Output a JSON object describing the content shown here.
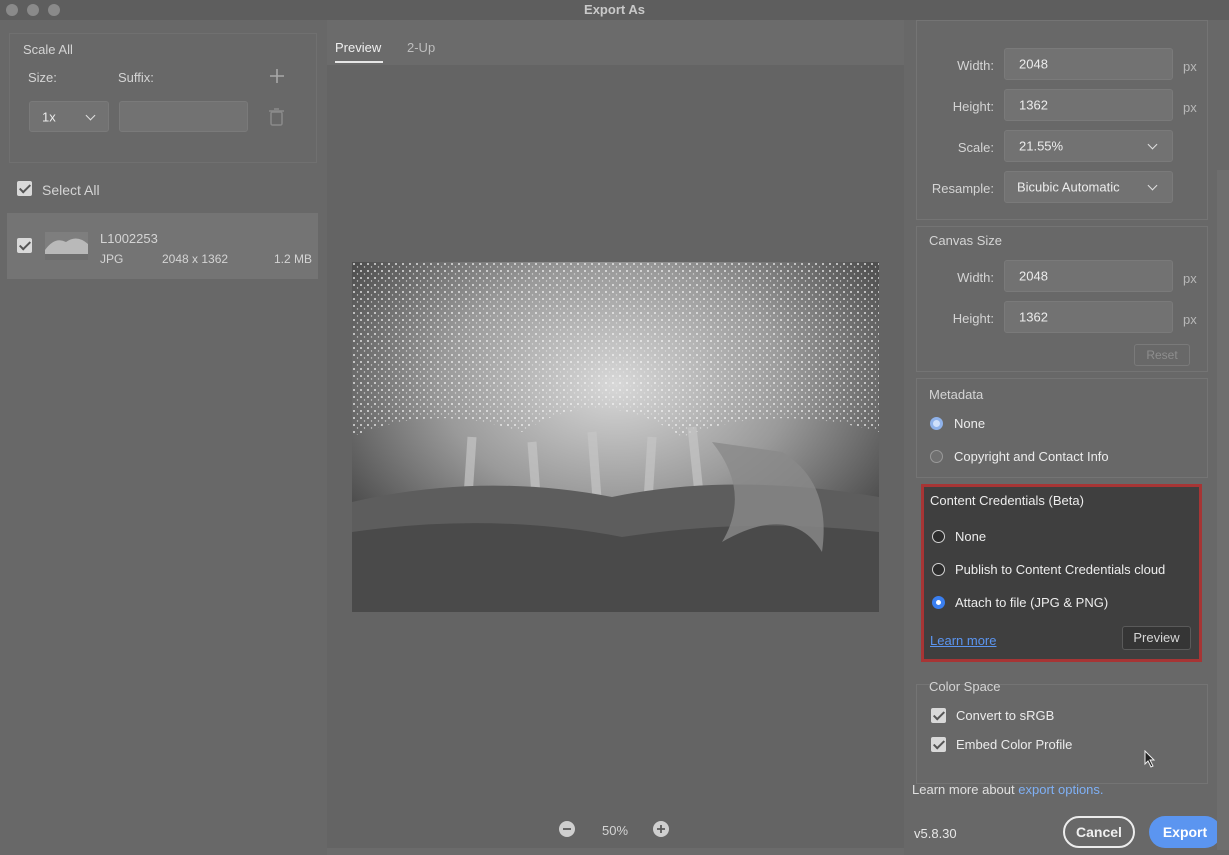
{
  "window": {
    "title": "Export As"
  },
  "left": {
    "scale_all": "Scale All",
    "size_label": "Size:",
    "suffix_label": "Suffix:",
    "size_value": "1x",
    "select_all": "Select All",
    "asset": {
      "name": "L1002253",
      "format": "JPG",
      "dimensions": "2048 x 1362",
      "filesize": "1.2 MB"
    }
  },
  "center": {
    "tabs": [
      "Preview",
      "2-Up"
    ],
    "zoom": "50%"
  },
  "right": {
    "image_size": {
      "width_label": "Width:",
      "width": "2048",
      "height_label": "Height:",
      "height": "1362",
      "scale_label": "Scale:",
      "scale": "21.55%",
      "resample_label": "Resample:",
      "resample": "Bicubic Automatic",
      "unit": "px"
    },
    "canvas_size": {
      "title": "Canvas Size",
      "width_label": "Width:",
      "width": "2048",
      "height_label": "Height:",
      "height": "1362",
      "reset": "Reset"
    },
    "metadata": {
      "title": "Metadata",
      "options": [
        "None",
        "Copyright and Contact Info"
      ],
      "selected": "None"
    },
    "content_credentials": {
      "title": "Content Credentials (Beta)",
      "options": [
        "None",
        "Publish to Content Credentials cloud",
        "Attach to file (JPG & PNG)"
      ],
      "selected": "Attach to file (JPG & PNG)",
      "learn_more": "Learn more",
      "preview": "Preview"
    },
    "color_space": {
      "title": "Color Space",
      "convert": "Convert to sRGB",
      "embed": "Embed Color Profile"
    },
    "footer": {
      "learn_more_prefix": "Learn more about",
      "learn_more_link": "export options.",
      "version": "v5.8.30",
      "cancel": "Cancel",
      "export": "Export"
    }
  },
  "colors": {
    "accent": "#5b95f0",
    "highlight_border": "#a73535"
  }
}
